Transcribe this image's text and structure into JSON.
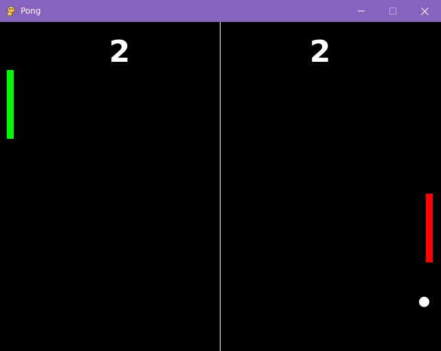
{
  "window": {
    "title": "Pong",
    "icon": "pygame-snake-icon",
    "titlebar_color": "#8763bd",
    "controls": [
      "minimize-icon",
      "maximize-icon",
      "close-icon"
    ]
  },
  "game": {
    "background_color": "#000000",
    "net_color": "#ffffff",
    "score_left": "2",
    "score_right": "2",
    "left_paddle_color": "#00ff00",
    "right_paddle_color": "#ff0000",
    "ball_color": "#ffffff"
  }
}
